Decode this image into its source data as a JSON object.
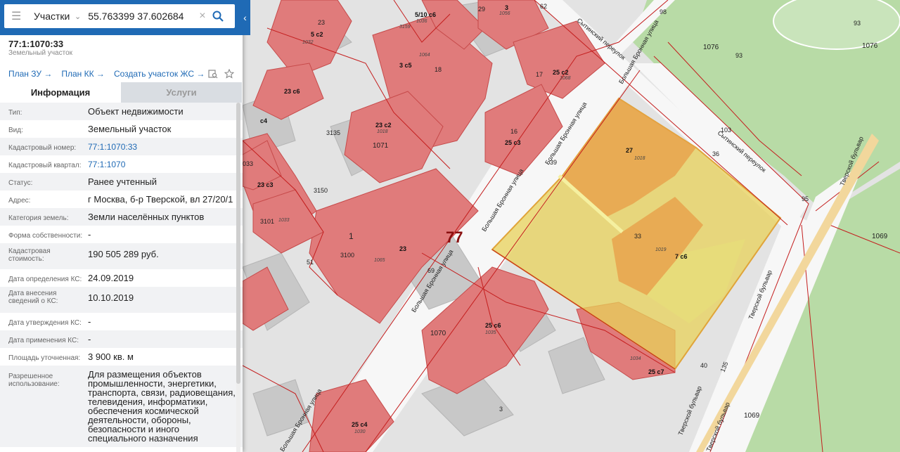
{
  "search": {
    "mode": "Участки",
    "query": "55.763399 37.602684"
  },
  "object": {
    "title": "77:1:1070:33",
    "type": "Земельный участок"
  },
  "links": [
    {
      "label": "План ЗУ"
    },
    {
      "label": "План КК"
    },
    {
      "label": "Создать участок ЖС"
    }
  ],
  "tabs": {
    "info": "Информация",
    "services": "Услуги"
  },
  "info": [
    {
      "key": "Тип:",
      "value": "Объект недвижимости"
    },
    {
      "key": "Вид:",
      "value": "Земельный участок"
    },
    {
      "key": "Кадастровый номер:",
      "value": "77:1:1070:33"
    },
    {
      "key": "Кадастровый квартал:",
      "value": "77:1:1070"
    },
    {
      "key": "Статус:",
      "value": "Ранее учтенный"
    },
    {
      "key": "Адрес:",
      "value": "г Москва, б-р Тверской, вл 27/20/1"
    },
    {
      "key": "Категория земель:",
      "value": "Земли населённых пунктов"
    },
    {
      "key": "Форма собственности:",
      "value": "-"
    },
    {
      "key": "Кадастровая стоимость:",
      "value": "190 505 289 руб."
    },
    {
      "key": "Дата определения КС:",
      "value": "24.09.2019"
    },
    {
      "key": "Дата внесения сведений о КС:",
      "value": "10.10.2019"
    },
    {
      "key": "Дата утверждения КС:",
      "value": "-"
    },
    {
      "key": "Дата применения КС:",
      "value": "-"
    },
    {
      "key": "Площадь уточненная:",
      "value": "3 900 кв. м"
    },
    {
      "key": "Разрешенное использование:",
      "value": "Для размещения объектов промышленности, энергетики, транспорта, связи, радиовещания, телевидения, информатики, обеспечения космической деятельности, обороны, безопасности и иного специального назначения"
    }
  ],
  "map": {
    "district_label": "77",
    "streets": {
      "bronnaya_upper": "Большая Бронная улица",
      "bronnaya_mid": "Большая Бронная улица",
      "bronnaya_lower": "Большая Бронная улица",
      "bronnaya_bottom": "Большая Бронная улица",
      "sytinsky_top": "Сытинский переулок",
      "sytinsky_right": "Сытинский переулок",
      "tverskoy_1": "Тверской бульвар",
      "tverskoy_2": "Тверской бульвар",
      "tverskoy_3": "Тверской бульвар",
      "tverskoy_4": "Тверской бульвар"
    },
    "labels": {
      "b5c2": "5 с2",
      "n1032": "1032",
      "n23a": "23",
      "b510c6": "5/10 с6",
      "n1036": "1036",
      "n3159": "3159",
      "n29": "29",
      "b3": "3",
      "n1056": "1056",
      "n62": "62",
      "n98": "98",
      "n93a": "93",
      "n93b": "93",
      "n1076a": "1076",
      "n1076b": "1076",
      "b3c5": "3 с5",
      "n1064": "1064",
      "n18": "18",
      "n17": "17",
      "b25c2": "25 с2",
      "n1068": "1068",
      "b23c6": "23 с6",
      "bc4": "с4",
      "b23c2": "23 с2",
      "n1018a": "1018",
      "n3135": "3135",
      "n1071": "1071",
      "n16": "16",
      "b25c3": "25 с3",
      "b27": "27",
      "n1018b": "1018",
      "n103": "103",
      "n36": "36",
      "n033": "033",
      "b23c3": "23 с3",
      "n3150": "3150",
      "n3101": "3101",
      "n1033": "1033",
      "n1": "1",
      "n3100": "3100",
      "b23": "23",
      "n1065": "1065",
      "n51": "51",
      "n69": "69",
      "n33": "33",
      "n1019": "1019",
      "b7c6": "7 с6",
      "n95": "95",
      "n1069a": "1069",
      "n1070": "1070",
      "b25c6": "25 с6",
      "n1035": "1035",
      "n1034": "1034",
      "b25c7": "25 с7",
      "n40": "40",
      "n135": "135",
      "n3": "3",
      "b25c4": "25 с4",
      "n1030": "1030",
      "n1069b": "1069",
      "n39": "39"
    }
  }
}
